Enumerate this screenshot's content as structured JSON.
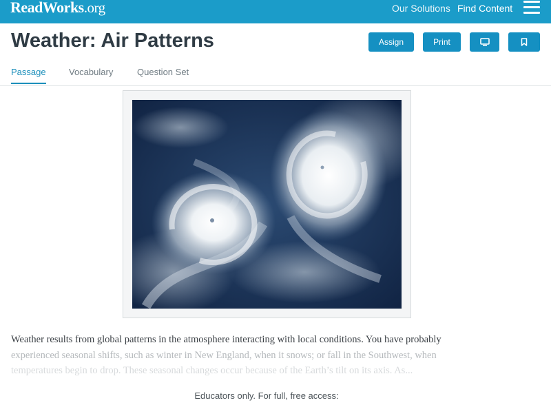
{
  "header": {
    "logo_main": "ReadWorks",
    "logo_tld": ".org",
    "nav": [
      "Our Solutions",
      "Find Content"
    ],
    "menu_icon": "hamburger-menu-icon",
    "bar_color": "#1b9cc9"
  },
  "page": {
    "title": "Weather: Air Patterns",
    "buttons": {
      "assign": "Assign",
      "print": "Print",
      "present_icon": "monitor-icon",
      "bookmark_icon": "bookmark-icon"
    },
    "button_color": "#1590c2",
    "tabs": [
      "Passage",
      "Vocabulary",
      "Question Set"
    ],
    "active_tab": "Passage"
  },
  "image": {
    "description_icon": "satellite-hurricane-image"
  },
  "passage": {
    "lines": [
      "Weather results from global patterns in the atmosphere interacting with local conditions. You have probably",
      "experienced seasonal shifts, such as winter in New England, when it snows; or fall in the Southwest, when",
      "temperatures begin to drop. These seasonal changes occur because of the Earth’s tilt on its axis. As..."
    ]
  },
  "footer": {
    "access_note": "Educators only. For full, free access:"
  }
}
